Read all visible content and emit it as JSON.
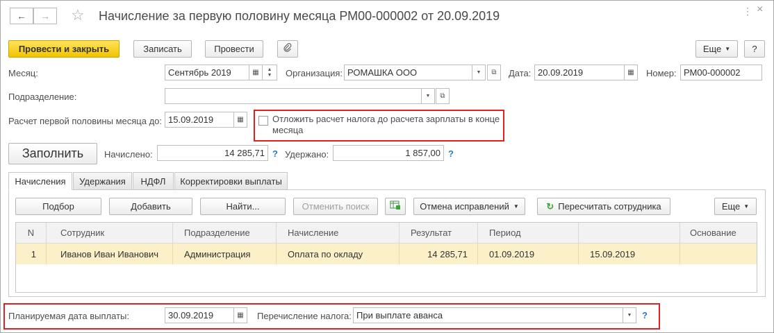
{
  "window": {
    "title": "Начисление за первую половину месяца РМ00-000002 от 20.09.2019"
  },
  "toolbar": {
    "post_close": "Провести и закрыть",
    "save": "Записать",
    "post": "Провести",
    "more": "Еще",
    "help": "?"
  },
  "form": {
    "month_label": "Месяц:",
    "month_value": "Сентябрь 2019",
    "org_label": "Организация:",
    "org_value": "РОМАШКА ООО",
    "date_label": "Дата:",
    "date_value": "20.09.2019",
    "number_label": "Номер:",
    "number_value": "РМ00-000002",
    "division_label": "Подразделение:",
    "division_value": "",
    "calc_until_label": "Расчет первой половины месяца до:",
    "calc_until_value": "15.09.2019",
    "postpone_tax_label": "Отложить расчет налога до расчета зарплаты в конце месяца",
    "postpone_tax_checked": false,
    "fill_button": "Заполнить",
    "accrued_label": "Начислено:",
    "accrued_value": "14 285,71",
    "withheld_label": "Удержано:",
    "withheld_value": "1 857,00",
    "q": "?"
  },
  "tabs": [
    {
      "label": "Начисления",
      "active": true
    },
    {
      "label": "Удержания",
      "active": false
    },
    {
      "label": "НДФЛ",
      "active": false
    },
    {
      "label": "Корректировки выплаты",
      "active": false
    }
  ],
  "table_toolbar": {
    "select": "Подбор",
    "add": "Добавить",
    "find": "Найти...",
    "cancel_search": "Отменить поиск",
    "corrections": "Отмена исправлений",
    "recalc": "Пересчитать сотрудника",
    "more": "Еще"
  },
  "table": {
    "columns": [
      "N",
      "Сотрудник",
      "Подразделение",
      "Начисление",
      "Результат",
      "Период",
      "",
      "Основание"
    ],
    "rows": [
      [
        "1",
        "Иванов Иван Иванович",
        "Администрация",
        "Оплата по окладу",
        "14 285,71",
        "01.09.2019",
        "15.09.2019",
        ""
      ]
    ]
  },
  "footer": {
    "pay_date_label": "Планируемая дата выплаты:",
    "pay_date_value": "30.09.2019",
    "tax_transfer_label": "Перечисление налога:",
    "tax_transfer_value": "При выплате аванса",
    "q": "?"
  },
  "colors": {
    "primary_button": "#f2c300",
    "highlight_row": "#fbf0c7",
    "red_frame": "#e02020",
    "help_blue": "#2a79c6"
  }
}
